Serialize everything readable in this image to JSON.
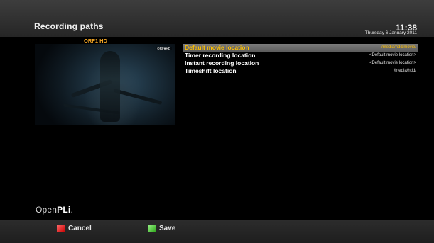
{
  "header": {
    "title": "Recording paths",
    "time": "11:38",
    "date": "Thursday 6 January 2011"
  },
  "preview": {
    "channel": "ORF1 HD",
    "station_logo": "ORF■HD"
  },
  "settings": [
    {
      "label": "Default movie location",
      "value": "/media/hdd/movie/",
      "selected": true
    },
    {
      "label": "Timer recording location",
      "value": "<Default movie location>",
      "selected": false
    },
    {
      "label": "Instant recording location",
      "value": "<Default movie location>",
      "selected": false
    },
    {
      "label": "Timeshift location",
      "value": "/media/hdd/",
      "selected": false
    }
  ],
  "brand": {
    "prefix": "Open",
    "suffix": "PLi",
    "dot": "."
  },
  "footer": {
    "cancel_label": "Cancel",
    "save_label": "Save",
    "cancel_color": "#e02020",
    "save_color": "#3cc028"
  },
  "colors": {
    "selection_text": "#ffc000",
    "channel_name": "#f5a623"
  }
}
